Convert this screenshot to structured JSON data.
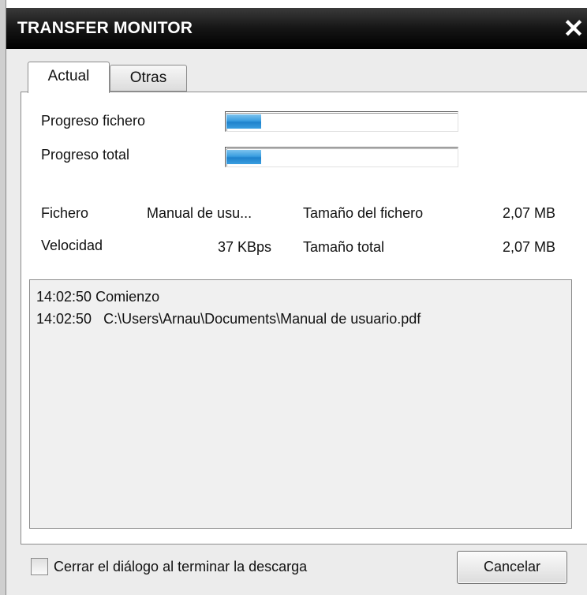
{
  "window": {
    "title": "TRANSFER MONITOR",
    "close_glyph": "✕"
  },
  "tabs": [
    {
      "label": "Actual",
      "selected": true
    },
    {
      "label": "Otras",
      "selected": false
    }
  ],
  "progress": {
    "file": {
      "label": "Progreso fichero",
      "fraction": 0.15
    },
    "total": {
      "label": "Progreso total",
      "fraction": 0.15
    }
  },
  "info": {
    "file_label": "Fichero",
    "file_value": "Manual de usu...",
    "file_size_label": "Tamaño del fichero",
    "file_size_value": "2,07 MB",
    "speed_label": "Velocidad",
    "speed_value": "37 KBps",
    "total_size_label": "Tamaño total",
    "total_size_value": "2,07 MB"
  },
  "log": [
    "14:02:50 Comienzo",
    "14:02:50   C:\\Users\\Arnau\\Documents\\Manual de usuario.pdf"
  ],
  "footer": {
    "checkbox_label": "Cerrar el diálogo al terminar la descarga",
    "checkbox_checked": false,
    "cancel_label": "Cancelar"
  },
  "colors": {
    "progress_fill": "#2b8fd8",
    "titlebar": "#111111"
  }
}
